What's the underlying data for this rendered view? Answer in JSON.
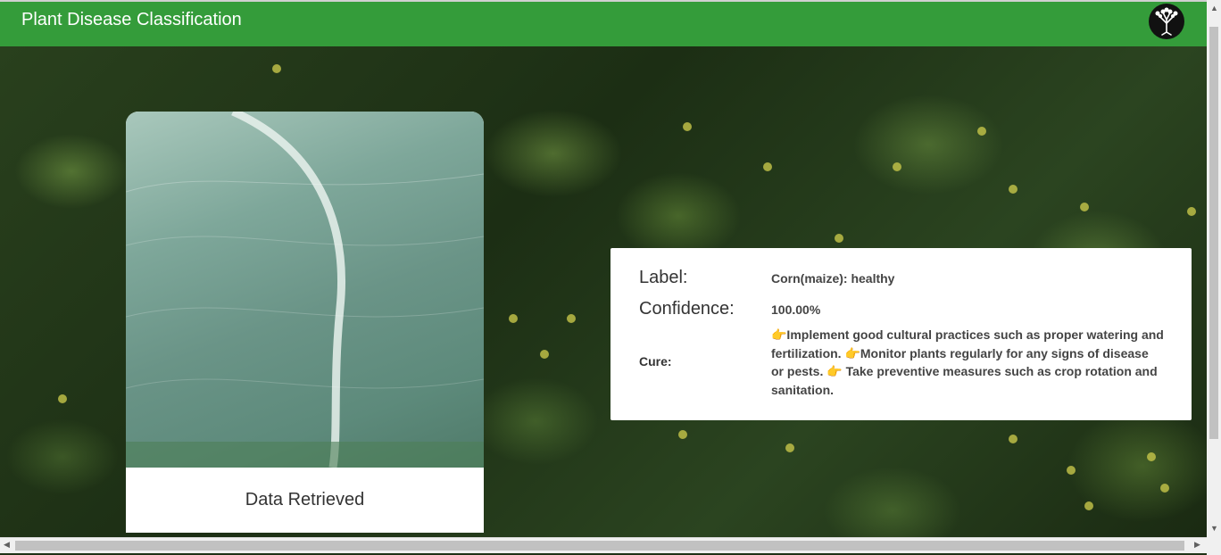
{
  "navbar": {
    "title": "Plant Disease Classification",
    "logo_icon": "tree-icon",
    "color": "#349c3a"
  },
  "image_card": {
    "caption": "Data Retrieved"
  },
  "result": {
    "label_title": "Label:",
    "label_value": "Corn(maize): healthy",
    "confidence_title": "Confidence:",
    "confidence_value": "100.00%",
    "cure_title": "Cure:",
    "cure_value": "👉Implement good cultural practices such as proper watering and fertilization. 👉Monitor plants regularly for any signs of disease or pests. 👉 Take preventive measures such as crop rotation and sanitation."
  }
}
